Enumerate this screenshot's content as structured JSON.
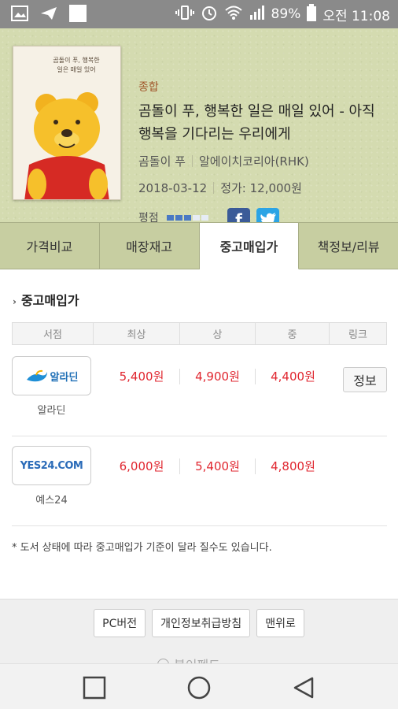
{
  "status_bar": {
    "battery": "89%",
    "time": "오전 11:08",
    "icons": [
      "image-icon",
      "send-icon",
      "square-icon",
      "vibrate-icon",
      "alarm-icon",
      "wifi-icon",
      "signal-icon",
      "battery-icon"
    ]
  },
  "book": {
    "genre": "종합",
    "title": "곰돌이 푸, 행복한 일은 매일 있어 - 아직 행복을 기다리는 우리에게",
    "author": "곰돌이 푸",
    "publisher": "알에이치코리아(RHK)",
    "date": "2018-03-12",
    "price": "정가: 12,000원",
    "rating_label": "평점",
    "rating_value": 0.6,
    "cover_title": "곰돌이 푸, 행복한 일은 매일 있어"
  },
  "social": {
    "facebook": "f",
    "twitter": "t"
  },
  "tabs": [
    {
      "label": "가격비교"
    },
    {
      "label": "매장재고"
    },
    {
      "label": "중고매입가"
    },
    {
      "label": "책정보/리뷰"
    }
  ],
  "section": {
    "title": "중고매입가"
  },
  "table": {
    "headers": [
      "서점",
      "최상",
      "상",
      "중",
      "링크"
    ],
    "rows": [
      {
        "store": "알라딘",
        "logo_text": "알라딘",
        "prices": [
          "5,400원",
          "4,900원",
          "4,400원"
        ],
        "link": "정보"
      },
      {
        "store": "예스24",
        "logo_text": "YES24.COM",
        "prices": [
          "6,000원",
          "5,400원",
          "4,800원"
        ],
        "link": ""
      }
    ]
  },
  "note": "* 도서 상태에 따라 중고매입가 기준이 달라 질수도 있습니다.",
  "footer": {
    "buttons": [
      "PC버전",
      "개인정보취급방침",
      "맨위로"
    ],
    "cutoff": "북이펜드"
  },
  "colors": {
    "header_bg": "#d4dbb0",
    "price": "#e0262f",
    "genre": "#a0552a",
    "facebook": "#3b5b98",
    "twitter": "#2ba4e5"
  }
}
